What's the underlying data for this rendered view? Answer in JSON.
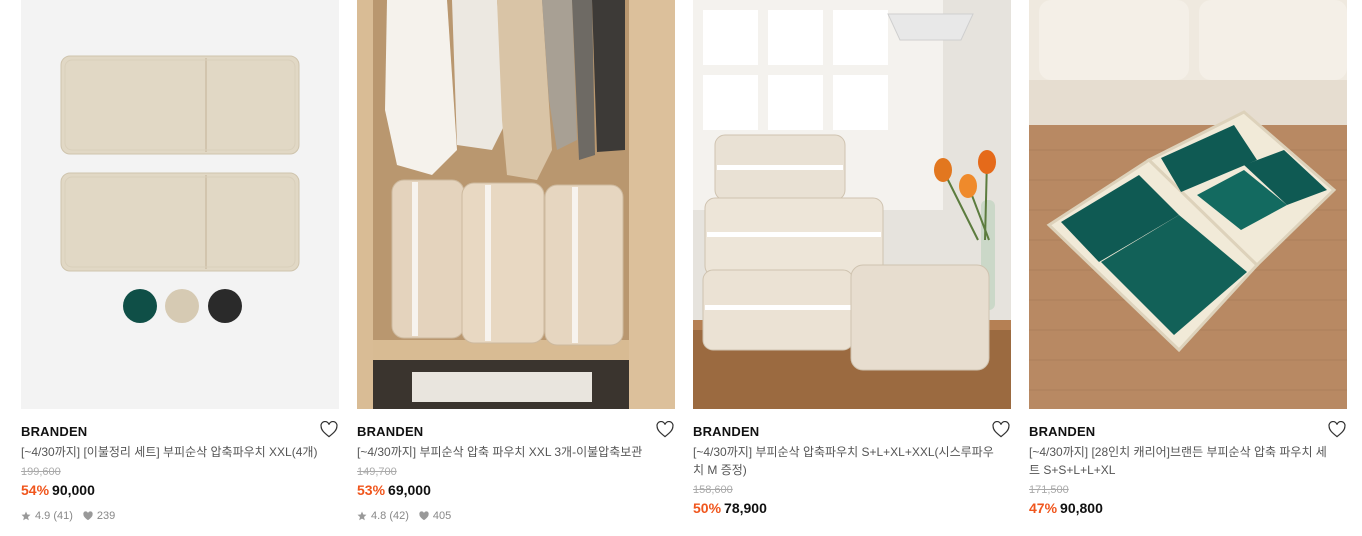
{
  "products": [
    {
      "brand": "BRANDEN",
      "title": "[~4/30까지] [이불정리 세트] 부피순삭 압축파우치 XXL(4개)",
      "original_price": "199,600",
      "discount": "54%",
      "price": "90,000",
      "rating": "4.9",
      "reviews": "(41)",
      "likes": "239",
      "image": "beige-pouches-with-color-swatches",
      "swatch_colors": [
        "#0f4f47",
        "#d6cab3",
        "#2a2a2a"
      ]
    },
    {
      "brand": "BRANDEN",
      "title": "[~4/30까지] 부피순삭 압축 파우치 XXL 3개-이불압축보관",
      "original_price": "149,700",
      "discount": "53%",
      "price": "69,000",
      "rating": "4.8",
      "reviews": "(42)",
      "likes": "405",
      "image": "pouches-in-wardrobe"
    },
    {
      "brand": "BRANDEN",
      "title": "[~4/30까지] 부피순삭 압축파우치 S+L+XL+XXL(시스루파우치 M 증정)",
      "original_price": "158,600",
      "discount": "50%",
      "price": "78,900",
      "image": "stacked-pouches-with-tulips"
    },
    {
      "brand": "BRANDEN",
      "title": "[~4/30까지] [28인치 캐리어]브랜든 부피순삭 압축 파우치 세트 S+S+L+L+XL",
      "original_price": "171,500",
      "discount": "47%",
      "price": "90,800",
      "image": "green-pouches-in-suitcase"
    }
  ],
  "colors": {
    "discount": "#f0561d",
    "text": "#111111",
    "muted": "#888888"
  }
}
